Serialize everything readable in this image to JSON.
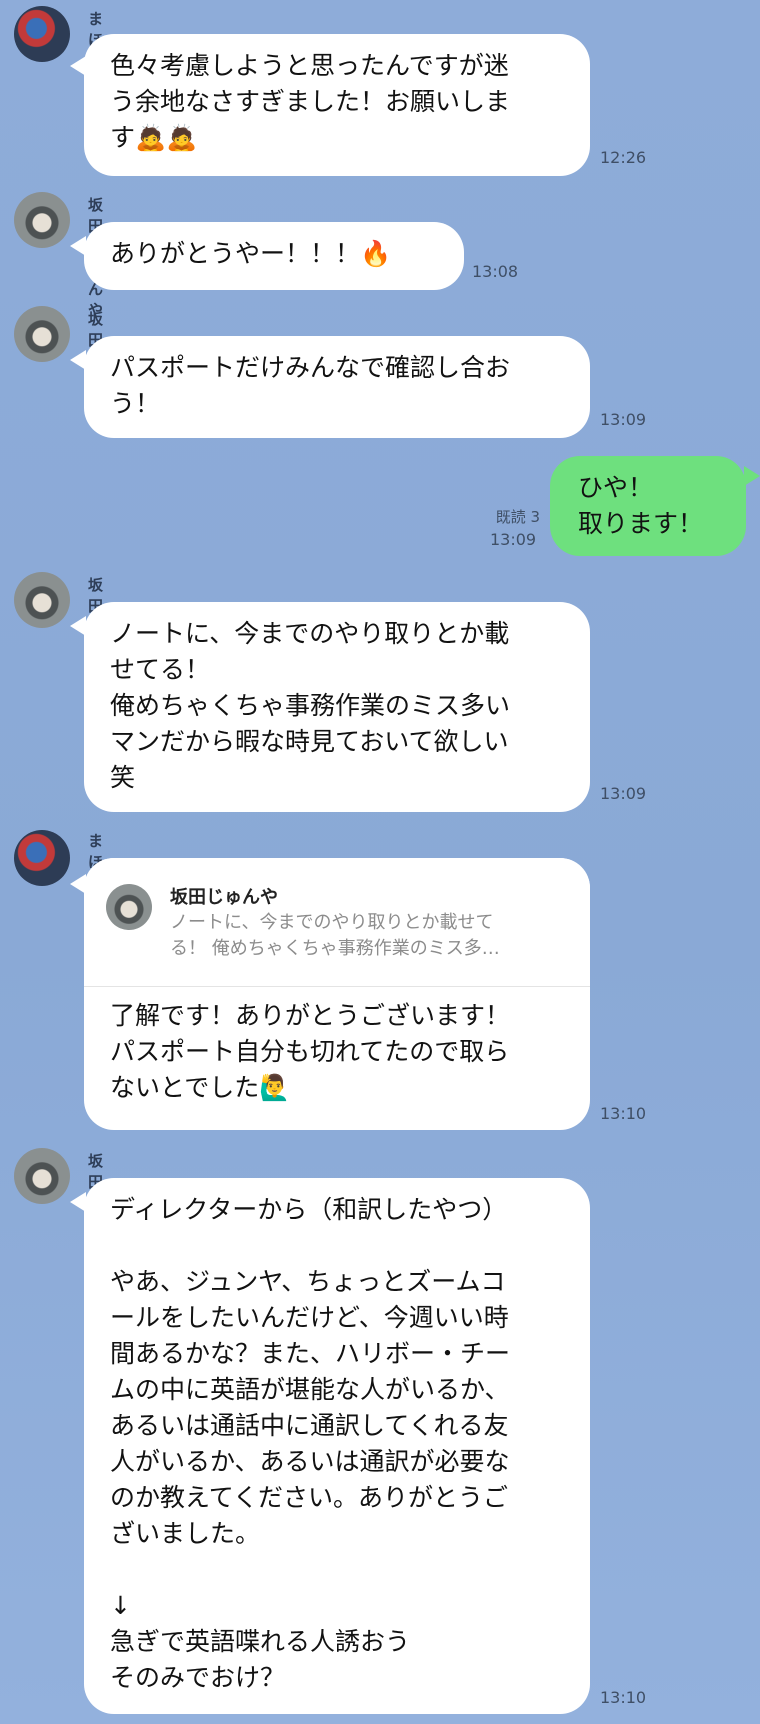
{
  "messages": [
    {
      "sender": "まほろ",
      "text": "色々考慮しようと思ったんですが迷\nう余地なさすぎました！お願いしま\nす🙇🙇",
      "time": "12:26"
    },
    {
      "sender": "坂田じゅんや",
      "text": "ありがとうやー！！！🔥",
      "time": "13:08"
    },
    {
      "sender": "坂田じゅんや",
      "text": "パスポートだけみんなで確認し合お\nう！",
      "time": "13:09"
    },
    {
      "sender": "me",
      "text": "ひや！\n取ります！",
      "time": "13:09",
      "read": "既読 3"
    },
    {
      "sender": "坂田じゅんや",
      "text": "ノートに、今までのやり取りとか載\nせてる！\n俺めちゃくちゃ事務作業のミス多い\nマンだから暇な時見ておいて欲しい\n笑",
      "time": "13:09"
    },
    {
      "sender": "まほろ",
      "reply_name": "坂田じゅんや",
      "reply_text": "ノートに、今までのやり取りとか載せて\nる！ 俺めちゃくちゃ事務作業のミス多…",
      "text": "了解です！ありがとうございます！\nパスポート自分も切れてたので取ら\nないとでした🙋‍♂️",
      "time": "13:10"
    },
    {
      "sender": "坂田じゅんや",
      "text": "ディレクターから（和訳したやつ）\n\nやあ、ジュンヤ、ちょっとズームコ\nールをしたいんだけど、今週いい時\n間あるかな？また、ハリボー・チー\nムの中に英語が堪能な人がいるか、\nあるいは通話中に通訳してくれる友\n人がいるか、あるいは通訳が必要な\nのか教えてください。ありがとうご\nざいました。\n\n↓\n急ぎで英語喋れる人誘おう\nそのみでおけ？",
      "time": "13:10"
    }
  ]
}
